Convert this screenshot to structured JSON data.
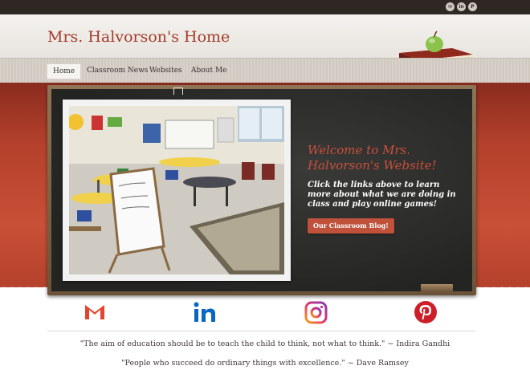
{
  "topbar": {
    "icons": [
      "mail-icon",
      "linkedin-icon",
      "pinterest-icon"
    ],
    "labels": [
      "✉",
      "in",
      "P"
    ]
  },
  "site": {
    "title": "Mrs. Halvorson's Home"
  },
  "nav": [
    {
      "label": "Home",
      "active": true
    },
    {
      "label": "Classroom News",
      "active": false
    },
    {
      "label": "Websites",
      "active": false
    },
    {
      "label": "About Me",
      "active": false
    }
  ],
  "hero": {
    "heading": "Welcome to Mrs. Halvorson's Website!",
    "text": "Click the links above to learn more about what we are doing in class and play online games!",
    "button": "Our Classroom Blog!"
  },
  "social": [
    "gmail-icon",
    "linkedin-icon",
    "instagram-icon",
    "pinterest-icon"
  ],
  "quotes": [
    "\"The aim of education should be to teach the child to think, not what to think.\" ~ Indira Gandhi",
    "\"People who succeed do ordinary things with excellence.\" ~ Dave Ramsey"
  ],
  "colors": {
    "accent": "#a33a2a",
    "band": "#c04a32",
    "button": "#c0513a",
    "board": "#2b2b2a"
  }
}
